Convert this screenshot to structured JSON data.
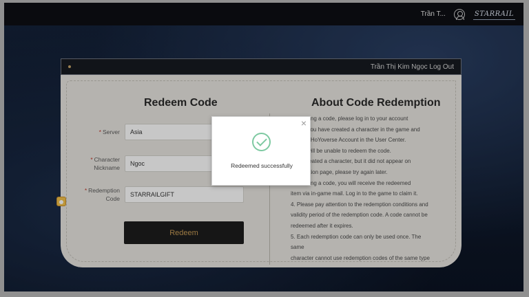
{
  "topbar": {
    "user_short": "Trần T...",
    "logo_text": "STARRAIL"
  },
  "card": {
    "header_user": "Trần Thị Kim Ngọc Log Out"
  },
  "form": {
    "title": "Redeem Code",
    "server_label": "Server",
    "server_value": "Asia",
    "nickname_label_line1": "Character",
    "nickname_label_line2": "Nickname",
    "nickname_value": "Ngoc",
    "code_label_line1": "Redemption",
    "code_label_line2": "Code",
    "code_value": "STARRAILGIFT",
    "required_mark": "*",
    "redeem_button": "Redeem"
  },
  "about": {
    "title": "About Code Redemption",
    "lines": [
      "redeeming a code, please log in to your account",
      "e sure you have created a character in the game and",
      "ed your HoYoverse Account in the User Center.",
      "e, you will be unable to redeem the code.",
      "have created a character, but it did not appear on",
      "redemption page, please try again later.",
      "redeeming a code, you will receive the redeemed",
      "item via in-game mail. Log in to the game to claim it.",
      "4. Please pay attention to the redemption conditions and",
      "validity period of the redemption code. A code cannot be",
      "redeemed after it expires.",
      "5. Each redemption code can only be used once. The same",
      "character cannot use redemption codes of the same type"
    ]
  },
  "modal": {
    "close_symbol": "×",
    "message": "Redeemed successfully"
  }
}
